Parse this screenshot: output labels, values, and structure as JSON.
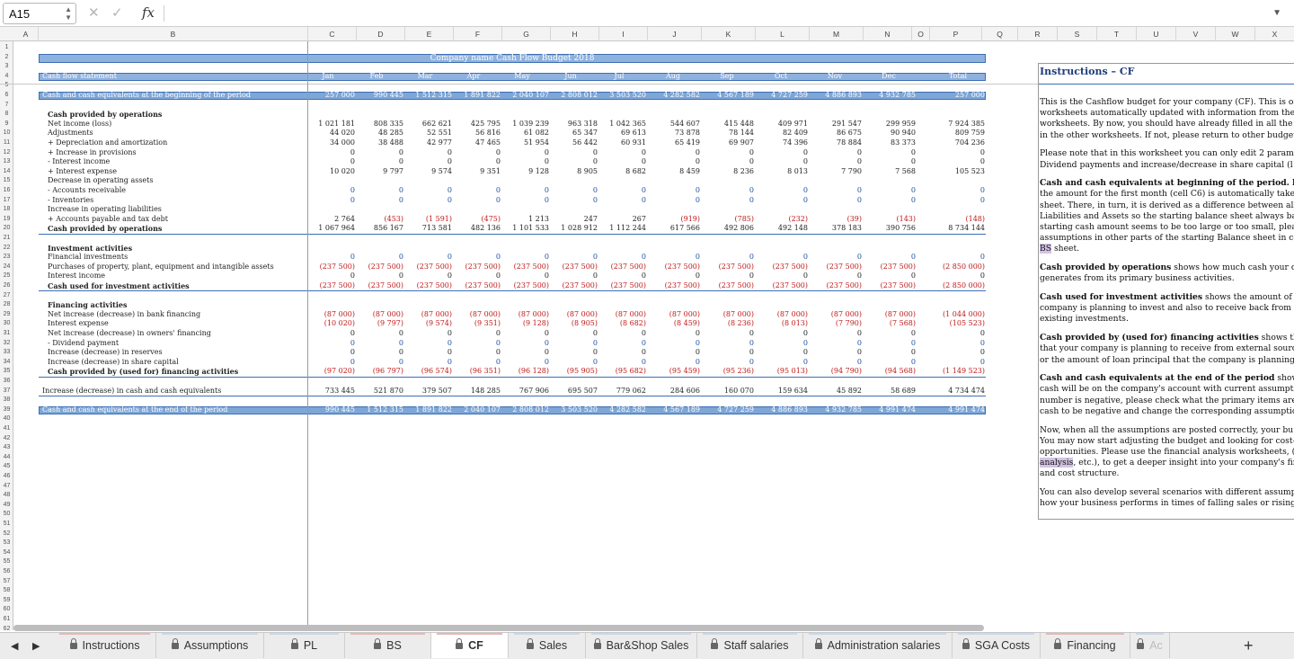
{
  "formula_bar": {
    "name_box": "A15",
    "fx": "fx",
    "formula": ""
  },
  "columns": [
    "A",
    "B",
    "C",
    "D",
    "E",
    "F",
    "G",
    "H",
    "I",
    "J",
    "K",
    "L",
    "M",
    "N",
    "O",
    "P",
    "Q",
    "R",
    "S",
    "T",
    "U",
    "V",
    "W",
    "X"
  ],
  "rows": [
    "1",
    "2",
    "3",
    "4",
    "5",
    "6",
    "7",
    "8",
    "9",
    "10",
    "11",
    "12",
    "13",
    "14",
    "15",
    "16",
    "17",
    "18",
    "19",
    "20",
    "21",
    "22",
    "23",
    "24",
    "25",
    "26",
    "27",
    "28",
    "29",
    "30",
    "31",
    "32",
    "33",
    "34",
    "35",
    "36",
    "37",
    "38",
    "39",
    "40",
    "41",
    "42",
    "43",
    "44",
    "45",
    "46",
    "47",
    "48",
    "49",
    "50",
    "51",
    "52",
    "53",
    "54",
    "55",
    "56",
    "57",
    "58",
    "59",
    "60",
    "61",
    "62"
  ],
  "title": "Company name Cash Flow Budget 2018",
  "header": {
    "label": "Cash flow statement",
    "months": [
      "Jan",
      "Feb",
      "Mar",
      "Apr",
      "May",
      "Jun",
      "Jul",
      "Aug",
      "Sep",
      "Oct",
      "Nov",
      "Dec",
      "Total"
    ]
  },
  "lines": [
    {
      "row": 6,
      "label": "Cash and cash equivalents at the beginning of the period",
      "style": "bar",
      "values": [
        "257 000",
        "990 445",
        "1 512 315",
        "1 891 822",
        "2 040 107",
        "2 808 012",
        "3 503 520",
        "4 282 582",
        "4 567 189",
        "4 727 259",
        "4 886 893",
        "4 932 785",
        "257 000"
      ]
    },
    {
      "row": 8,
      "label": "Cash provided by operations",
      "style": "bold",
      "values": []
    },
    {
      "row": 9,
      "label": "Net income (loss)",
      "values": [
        "1 021 181",
        "808 335",
        "662 621",
        "425 795",
        "1 039 239",
        "963 318",
        "1 042 365",
        "544 607",
        "415 448",
        "409 971",
        "291 547",
        "299 959",
        "7 924 385"
      ]
    },
    {
      "row": 10,
      "label": "Adjustments",
      "values": [
        "44 020",
        "48 285",
        "52 551",
        "56 816",
        "61 082",
        "65 347",
        "69 613",
        "73 878",
        "78 144",
        "82 409",
        "86 675",
        "90 940",
        "809 759"
      ]
    },
    {
      "row": 11,
      "label": "+ Depreciation and amortization",
      "values": [
        "34 000",
        "38 488",
        "42 977",
        "47 465",
        "51 954",
        "56 442",
        "60 931",
        "65 419",
        "69 907",
        "74 396",
        "78 884",
        "83 373",
        "704 236"
      ]
    },
    {
      "row": 12,
      "label": "+ Increase in provisions",
      "values": [
        "0",
        "0",
        "0",
        "0",
        "0",
        "0",
        "0",
        "0",
        "0",
        "0",
        "0",
        "0",
        "0"
      ]
    },
    {
      "row": 13,
      "label": "- Interest income",
      "values": [
        "0",
        "0",
        "0",
        "0",
        "0",
        "0",
        "0",
        "0",
        "0",
        "0",
        "0",
        "0",
        "0"
      ]
    },
    {
      "row": 14,
      "label": "+ Interest expense",
      "values": [
        "10 020",
        "9 797",
        "9 574",
        "9 351",
        "9 128",
        "8 905",
        "8 682",
        "8 459",
        "8 236",
        "8 013",
        "7 790",
        "7 568",
        "105 523"
      ]
    },
    {
      "row": 15,
      "label": "Decrease in operating assets",
      "values": []
    },
    {
      "row": 16,
      "label": "- Accounts receivable",
      "values": [
        "0",
        "0",
        "0",
        "0",
        "0",
        "0",
        "0",
        "0",
        "0",
        "0",
        "0",
        "0",
        "0"
      ],
      "color": "blue"
    },
    {
      "row": 17,
      "label": "- Inventories",
      "values": [
        "0",
        "0",
        "0",
        "0",
        "0",
        "0",
        "0",
        "0",
        "0",
        "0",
        "0",
        "0",
        "0"
      ],
      "color": "blue"
    },
    {
      "row": 18,
      "label": "Increase in operating liabilities",
      "values": []
    },
    {
      "row": 19,
      "label": "+ Accounts payable and tax debt",
      "values": [
        "2 764",
        "(453)",
        "(1 591)",
        "(475)",
        "1 213",
        "247",
        "267",
        "(919)",
        "(785)",
        "(232)",
        "(39)",
        "(143)",
        "(148)"
      ]
    },
    {
      "row": 20,
      "label": "Cash provided by operations",
      "style": "total",
      "values": [
        "1 067 964",
        "856 167",
        "713 581",
        "482 136",
        "1 101 533",
        "1 028 912",
        "1 112 244",
        "617 566",
        "492 806",
        "492 148",
        "378 183",
        "390 756",
        "8 734 144"
      ]
    },
    {
      "row": 22,
      "label": "Investment activities",
      "style": "bold",
      "values": []
    },
    {
      "row": 23,
      "label": "Financial investments",
      "values": [
        "0",
        "0",
        "0",
        "0",
        "0",
        "0",
        "0",
        "0",
        "0",
        "0",
        "0",
        "0",
        "0"
      ],
      "color": "blue"
    },
    {
      "row": 24,
      "label": "Purchases of property, plant, equipment and intangible assets",
      "values": [
        "(237 500)",
        "(237 500)",
        "(237 500)",
        "(237 500)",
        "(237 500)",
        "(237 500)",
        "(237 500)",
        "(237 500)",
        "(237 500)",
        "(237 500)",
        "(237 500)",
        "(237 500)",
        "(2 850 000)"
      ]
    },
    {
      "row": 25,
      "label": "Interest income",
      "values": [
        "0",
        "0",
        "0",
        "0",
        "0",
        "0",
        "0",
        "0",
        "0",
        "0",
        "0",
        "0",
        "0"
      ]
    },
    {
      "row": 26,
      "label": "Cash used for investment activities",
      "style": "total",
      "values": [
        "(237 500)",
        "(237 500)",
        "(237 500)",
        "(237 500)",
        "(237 500)",
        "(237 500)",
        "(237 500)",
        "(237 500)",
        "(237 500)",
        "(237 500)",
        "(237 500)",
        "(237 500)",
        "(2 850 000)"
      ]
    },
    {
      "row": 28,
      "label": "Financing activities",
      "style": "bold",
      "values": []
    },
    {
      "row": 29,
      "label": "Net increase (decrease) in bank financing",
      "values": [
        "(87 000)",
        "(87 000)",
        "(87 000)",
        "(87 000)",
        "(87 000)",
        "(87 000)",
        "(87 000)",
        "(87 000)",
        "(87 000)",
        "(87 000)",
        "(87 000)",
        "(87 000)",
        "(1 044 000)"
      ]
    },
    {
      "row": 30,
      "label": "Interest expense",
      "values": [
        "(10 020)",
        "(9 797)",
        "(9 574)",
        "(9 351)",
        "(9 128)",
        "(8 905)",
        "(8 682)",
        "(8 459)",
        "(8 236)",
        "(8 013)",
        "(7 790)",
        "(7 568)",
        "(105 523)"
      ]
    },
    {
      "row": 31,
      "label": "Net increase (decrease) in owners' financing",
      "values": [
        "0",
        "0",
        "0",
        "0",
        "0",
        "0",
        "0",
        "0",
        "0",
        "0",
        "0",
        "0",
        "0"
      ]
    },
    {
      "row": 32,
      "label": " - Dividend payment",
      "values": [
        "0",
        "0",
        "0",
        "0",
        "0",
        "0",
        "0",
        "0",
        "0",
        "0",
        "0",
        "0",
        "0"
      ],
      "color": "blue"
    },
    {
      "row": 33,
      "label": "Increase (decrease) in reserves",
      "values": [
        "0",
        "0",
        "0",
        "0",
        "0",
        "0",
        "0",
        "0",
        "0",
        "0",
        "0",
        "0",
        "0"
      ]
    },
    {
      "row": 34,
      "label": "Increase (decrease) in share capital",
      "values": [
        "0",
        "0",
        "0",
        "0",
        "0",
        "0",
        "0",
        "0",
        "0",
        "0",
        "0",
        "0",
        "0"
      ],
      "color": "blue"
    },
    {
      "row": 35,
      "label": "Cash provided by (used for) financing activities",
      "style": "total",
      "values": [
        "(97 020)",
        "(96 797)",
        "(96 574)",
        "(96 351)",
        "(96 128)",
        "(95 905)",
        "(95 682)",
        "(95 459)",
        "(95 236)",
        "(95 013)",
        "(94 790)",
        "(94 568)",
        "(1 149 523)"
      ]
    },
    {
      "row": 37,
      "label": "Increase (decrease) in cash and cash equivalents",
      "style": "line",
      "values": [
        "733 445",
        "521 870",
        "379 507",
        "148 285",
        "767 906",
        "695 507",
        "779 062",
        "284 606",
        "160 070",
        "159 634",
        "45 892",
        "58 689",
        "4 734 474"
      ]
    },
    {
      "row": 39,
      "label": "Cash and cash equivalents at the end of the period",
      "style": "bar",
      "values": [
        "990 445",
        "1 512 315",
        "1 891 822",
        "2 040 107",
        "2 808 012",
        "3 503 520",
        "4 282 582",
        "4 567 189",
        "4 727 259",
        "4 886 893",
        "4 932 785",
        "4 991 474",
        "4 991 474"
      ]
    }
  ],
  "instructions": {
    "title": "Instructions – CF",
    "paragraphs": [
      [
        "This is the Cashflow budget for your company (CF). This is on",
        "worksheets automatically updated with information from the",
        "worksheets. By now, you should have already filled in all the",
        "in the other worksheets. If not, please return to other budget"
      ],
      [
        "Please note that in this worksheet you can only edit 2 parame",
        "Dividend payments and increase/decrease in share capital (l"
      ],
      [
        "Cash and cash equivalents at beginning of the period. Ple",
        "the amount for the first month (cell C6) is automatically take",
        "sheet. There, in turn, it is derived as a difference between all",
        "Liabilities and Assets so the starting balance sheet always ba",
        "starting cash amount seems to be too large or too small, plea",
        "assumptions in other parts of the starting Balance sheet in co",
        "BS sheet."
      ],
      [
        "Cash provided by operations shows how much cash your c",
        "generates from its primary business activities."
      ],
      [
        "Cash used for investment activities shows the amount of c",
        "company is planning to invest and also to receive back from s",
        "existing investments."
      ],
      [
        "Cash provided by (used for) financing activities shows the",
        "that your company is planning to receive from external sourc",
        "or the amount of loan principal that the company is planning"
      ],
      [
        "Cash and cash equivalents at the end of the period shows",
        "cash will be on the company's account with current assumpti",
        "number is negative, please check what the primary items are",
        "cash to be negative and change the corresponding assumptio"
      ],
      [
        "Now, when all the assumptions are posted correctly, your bu",
        "You may now start adjusting the budget and looking for cost-",
        "opportunities. Please use the financial analysis worksheets, (",
        "analysis, etc.), to get a deeper insight into your company's fin",
        "and cost structure."
      ],
      [
        "You can also develop several scenarios with different assump",
        "how your business performs in times of falling sales or rising"
      ]
    ],
    "bold_leads": [
      "",
      "",
      "Cash and cash equivalents at beginning of the period.",
      "Cash provided by operations",
      "Cash used for investment activities",
      "Cash provided by (used for) financing activities",
      "Cash and cash equivalents at the end of the period",
      "",
      ""
    ]
  },
  "tabs": [
    {
      "label": "Instructions",
      "color": "#e7b7b7"
    },
    {
      "label": "Assumptions",
      "color": "#c9d8ee"
    },
    {
      "label": "PL",
      "color": "#c9d8ee"
    },
    {
      "label": "BS",
      "color": "#e7b7b7"
    },
    {
      "label": "CF",
      "color": "#e7b7b7",
      "active": true
    },
    {
      "label": "Sales",
      "color": "#c9d8ee"
    },
    {
      "label": "Bar&Shop Sales",
      "color": "#c9d8ee"
    },
    {
      "label": "Staff salaries",
      "color": "#c9d8ee"
    },
    {
      "label": "Administration salaries",
      "color": "#c9d8ee"
    },
    {
      "label": "SGA Costs",
      "color": "#c9d8ee"
    },
    {
      "label": "Financing",
      "color": "#e7b7b7"
    },
    {
      "label": "Ac",
      "color": "#c9d8ee"
    }
  ],
  "add_tab": "+"
}
